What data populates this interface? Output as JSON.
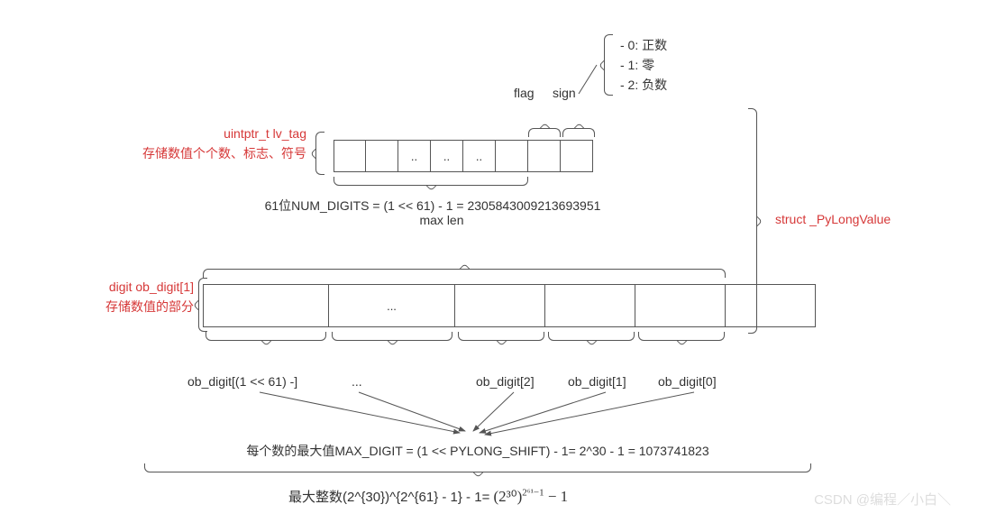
{
  "sign_list": {
    "item0": "- 0: 正数",
    "item1": "- 1: 零",
    "item2": "- 2: 负数"
  },
  "flag_label": "flag",
  "sign_label": "sign",
  "lv_tag": {
    "line1": "uintptr_t    lv_tag",
    "line2": "存储数值个个数、标志、符号"
  },
  "top_cells": {
    "c3": "..",
    "c4": "..",
    "c5": ".."
  },
  "num_digits": "61位NUM_DIGITS = (1 << 61) - 1 = 2305843009213693951",
  "max_len": "max len",
  "ob_digit_label": {
    "line1": "digit   ob_digit[1]",
    "line2": "存储数值的部分"
  },
  "big_cells": {
    "c1": "..."
  },
  "digit_labels": {
    "d0": "ob_digit[(1 << 61) -]",
    "d1": "...",
    "d2": "ob_digit[2]",
    "d3": "ob_digit[1]",
    "d4": "ob_digit[0]"
  },
  "max_digit": "每个数的最大值MAX_DIGIT = (1 << PYLONG_SHIFT) - 1= 2^30 - 1 = 1073741823",
  "max_int_prefix": "最大整数(2^{30})^{2^{61} - 1} - 1=",
  "max_int_formula": "(2³⁰)",
  "max_int_exp": "2⁶¹−1",
  "max_int_suffix": " − 1",
  "struct_label": "struct  _PyLongValue",
  "watermark": "CSDN @编程／小白＼"
}
